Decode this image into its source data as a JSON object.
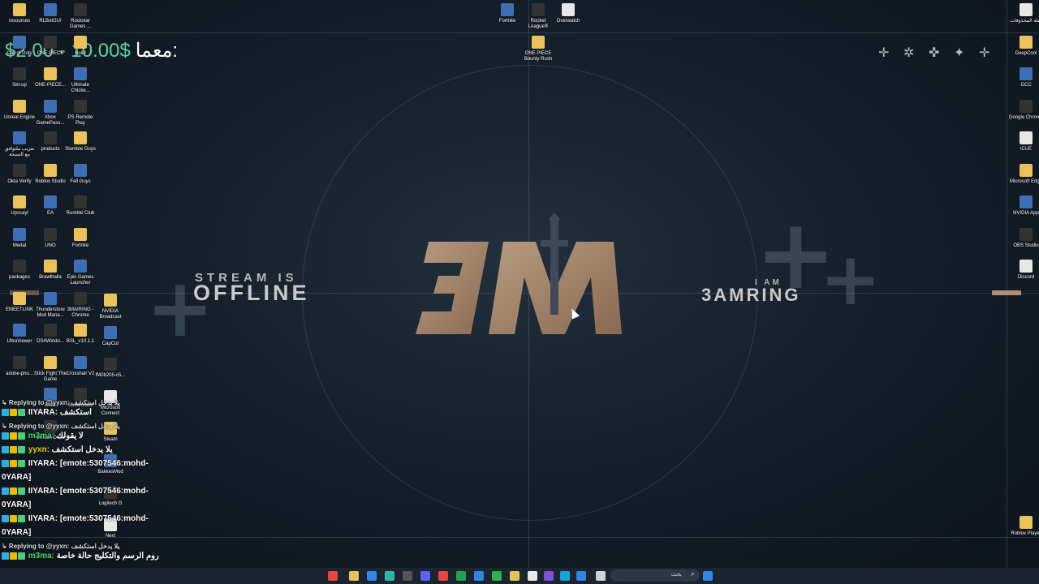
{
  "stream": {
    "offline_top": "STREAM IS",
    "offline_main": "OFFLINE",
    "iam_top": "I AM",
    "iam_main": "3AMRING",
    "logo_text": "3M"
  },
  "overlay": {
    "prices": "$2.00 - 10.00$",
    "label": "معما:"
  },
  "desktop_icons": {
    "col1": [
      "resources",
      "Call of Duty",
      "Set-up",
      "Unreal Engine",
      "تعريب ملتوافق مع النسخة",
      "Okta Verify",
      "Upscayl",
      "Medal",
      "packages",
      "EMEETLINK",
      "UltraViewer",
      "adobe-pho..."
    ],
    "col2": [
      "RLBotGUI",
      "ONE PIECE",
      "ONE-PIECE...",
      "Xbox GamePass...",
      "products",
      "Roblox Studio",
      "EA",
      "UNO",
      "Brawlhalla",
      "Thunderstore Mod Mana...",
      "DS4Windo...",
      "Stick Fight The Game",
      "Build",
      "Stream Deck"
    ],
    "col3": [
      "Rockstar Games ...",
      "Build",
      "Ultimate Chicke...",
      "PS Remote Play",
      "Stumble Guys",
      "Fall Guys",
      "Rumble Club",
      "Fortnite",
      "Epic Games Launcher",
      "3MAIRING - Chrome",
      "BSL_v10.1.1",
      "Crosshair V2",
      "Streamlabs"
    ],
    "col4": [
      "NVIDIA Broadcast",
      "CapCut",
      "ff40b205-c5...",
      "Microsoft Connect",
      "Steam",
      "BakkesMod",
      "Logitech G",
      "Next"
    ],
    "top": [
      "Fortnite",
      "Rocket League®",
      "Overwatch",
      "ONE PIECE Bounty Rush"
    ],
    "right": [
      "سلة المحذوفات",
      "DeepCool",
      "GCC",
      "Google Chrome",
      "iCUE",
      "Microsoft Edge",
      "NVIDIA App",
      "OBS Studio",
      "Discord",
      "Roblox Player"
    ]
  },
  "chat": [
    {
      "type": "reply",
      "text": "Replying to @yyxn: يلا يدخل استكشف"
    },
    {
      "type": "msg",
      "user": "IIYARA:",
      "user_class": "u-iiyara",
      "text": "استكشف"
    },
    {
      "type": "reply",
      "text": "Replying to @yyxn: يلا يدخل استكشف"
    },
    {
      "type": "msg",
      "user": "m3ma:",
      "user_class": "u-m3ma",
      "text": "لا يقولك"
    },
    {
      "type": "msg",
      "user": "yyxn:",
      "user_class": "u-yyxn",
      "text": "يلا يدخل استكشف"
    },
    {
      "type": "msg",
      "user": "IIYARA:",
      "user_class": "u-iiyara",
      "text": "[emote:5307546:mohd-"
    },
    {
      "type": "cont",
      "text": "0YARA]"
    },
    {
      "type": "msg",
      "user": "IIYARA:",
      "user_class": "u-iiyara",
      "text": "[emote:5307546:mohd-"
    },
    {
      "type": "cont",
      "text": "0YARA]"
    },
    {
      "type": "msg",
      "user": "IIYARA:",
      "user_class": "u-iiyara",
      "text": "[emote:5307546:mohd-"
    },
    {
      "type": "cont",
      "text": "0YARA]"
    },
    {
      "type": "reply",
      "text": "Replying to @yyxn: يلا يدخل استكشف"
    },
    {
      "type": "msg",
      "user": "m3ma:",
      "user_class": "u-m3ma",
      "text": "روم الرسم والتكليج حالة خاصة"
    }
  ],
  "taskbar": {
    "search_text": "بحث"
  }
}
